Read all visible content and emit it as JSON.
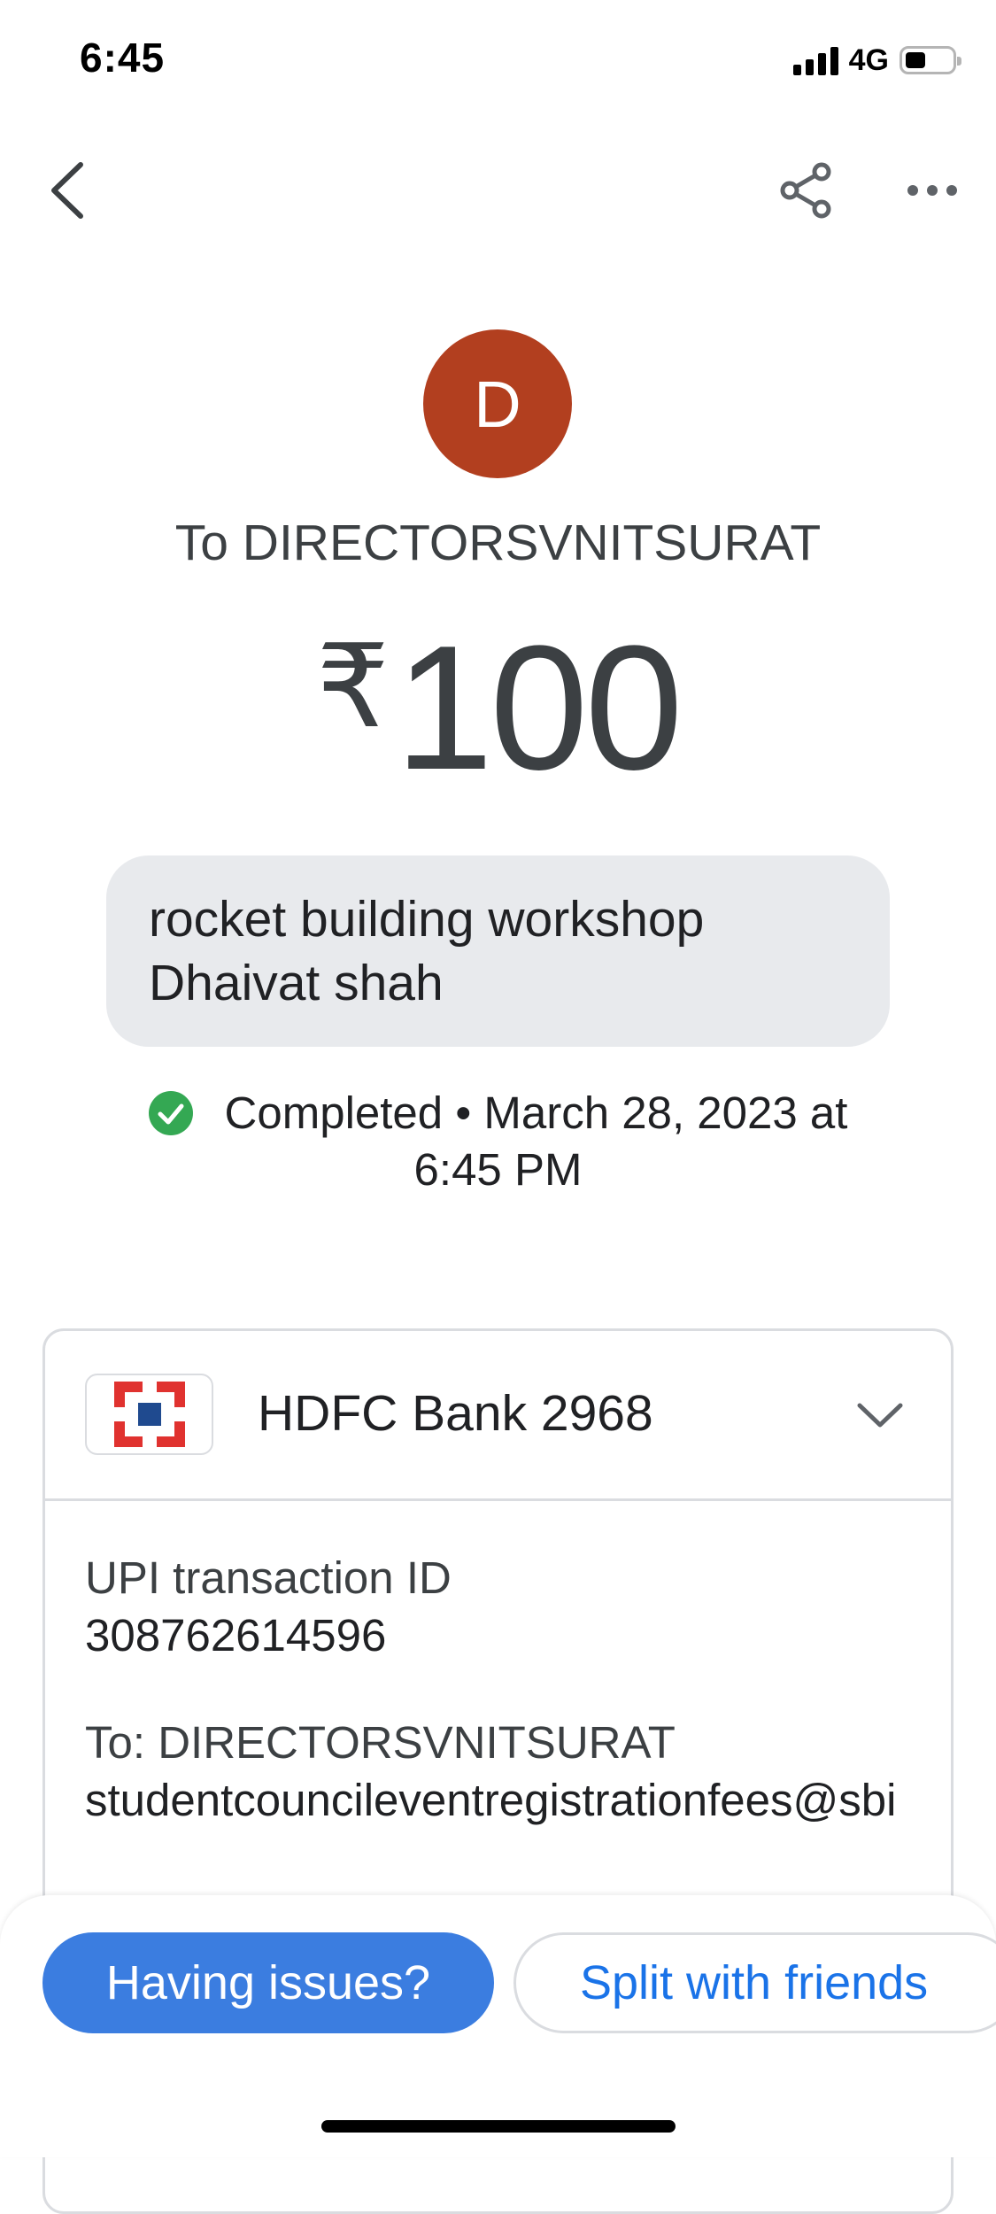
{
  "status_bar": {
    "time": "6:45",
    "network": "4G",
    "icons": [
      "signal-icon",
      "battery-icon"
    ]
  },
  "top_bar": {
    "icons": [
      "back-arrow-icon",
      "share-icon",
      "more-horizontal-icon"
    ]
  },
  "payment": {
    "avatar_letter": "D",
    "avatar_color": "#b23f1f",
    "recipient_title": "To DIRECTORSVNITSURAT",
    "currency_symbol": "₹",
    "amount": "100",
    "note_line_1": "rocket building workshop",
    "note_line_2": "Dhaivat shah",
    "status_text_line_1": "Completed • March 28, 2023 at",
    "status_text_line_2": "6:45 PM",
    "status_icon": "check-circle-icon",
    "status_color": "#34a853"
  },
  "details": {
    "bank_name": "HDFC Bank 2968",
    "bank_logo": "hdfc-logo-icon",
    "upi_label": "UPI transaction ID",
    "upi_value": "308762614596",
    "to_label": "To: DIRECTORSVNITSURAT",
    "to_value": "studentcouncileventregistrationfees@sbi",
    "expand_icon": "chevron-down-icon"
  },
  "actions": {
    "issues_label": "Having issues?",
    "split_label": "Split with friends",
    "primary_color": "#3b7de0",
    "link_color": "#1a73e8"
  }
}
